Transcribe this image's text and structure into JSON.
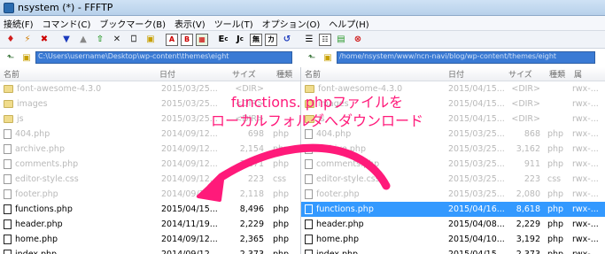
{
  "window": {
    "title": "nsystem (*) - FFFTP"
  },
  "menu": [
    "接続(F)",
    "コマンド(C)",
    "ブックマーク(B)",
    "表示(V)",
    "ツール(T)",
    "オプション(O)",
    "ヘルプ(H)"
  ],
  "toolbar": {
    "icons": [
      "connect-icon",
      "quick-connect-icon",
      "disconnect-icon",
      "download-icon",
      "upload-icon",
      "mirror-upload-icon",
      "delete-icon",
      "rename-icon",
      "mkdir-icon",
      "ascii-mode-icon",
      "binary-mode-icon",
      "auto-mode-icon",
      "ec-icon",
      "jc-icon",
      "kanji-icon",
      "kana-icon",
      "refresh-icon",
      "list-view-icon",
      "detail-view-icon",
      "sync-icon",
      "stop-icon"
    ],
    "labels": {
      "ascii": "A",
      "binary": "B",
      "ec": "E",
      "ec_sub": "c",
      "jc": "J",
      "jc_sub": "c",
      "kanji": "無",
      "kana": "カ"
    }
  },
  "local": {
    "path": "C:\\Users\\username\\Desktop\\wp-content\\themes\\eight",
    "columns": {
      "name": "名前",
      "date": "日付",
      "size": "サイズ",
      "kind": "種類"
    },
    "rows": [
      {
        "name": "font-awesome-4.3.0",
        "date": "2015/03/25...",
        "size": "<DIR>",
        "kind": "",
        "type": "folder",
        "state": "dim"
      },
      {
        "name": "images",
        "date": "2015/03/25...",
        "size": "<DIR>",
        "kind": "",
        "type": "folder",
        "state": "dim"
      },
      {
        "name": "js",
        "date": "2015/03/25...",
        "size": "<DIR>",
        "kind": "",
        "type": "folder",
        "state": "dim"
      },
      {
        "name": "404.php",
        "date": "2014/09/12...",
        "size": "698",
        "kind": "php",
        "type": "file",
        "state": "dim"
      },
      {
        "name": "archive.php",
        "date": "2014/09/12...",
        "size": "2,154",
        "kind": "php",
        "type": "file",
        "state": "dim"
      },
      {
        "name": "comments.php",
        "date": "2014/09/12...",
        "size": "2,171",
        "kind": "php",
        "type": "file",
        "state": "dim"
      },
      {
        "name": "editor-style.css",
        "date": "2014/09/12...",
        "size": "223",
        "kind": "css",
        "type": "file",
        "state": "dim"
      },
      {
        "name": "footer.php",
        "date": "2014/09/12...",
        "size": "2,118",
        "kind": "php",
        "type": "file",
        "state": "dim"
      },
      {
        "name": "functions.php",
        "date": "2015/04/15...",
        "size": "8,496",
        "kind": "php",
        "type": "file",
        "state": "active"
      },
      {
        "name": "header.php",
        "date": "2014/11/19...",
        "size": "2,229",
        "kind": "php",
        "type": "file",
        "state": "active"
      },
      {
        "name": "home.php",
        "date": "2014/09/12...",
        "size": "2,365",
        "kind": "php",
        "type": "file",
        "state": "active"
      },
      {
        "name": "index.php",
        "date": "2014/09/12...",
        "size": "2,373",
        "kind": "php",
        "type": "file",
        "state": "active"
      }
    ]
  },
  "remote": {
    "path": "/home/nsystem/www/ncn-navi/blog/wp-content/themes/eight",
    "columns": {
      "name": "名前",
      "date": "日付",
      "size": "サイズ",
      "kind": "種類",
      "attr": "属"
    },
    "rows": [
      {
        "name": "font-awesome-4.3.0",
        "date": "2015/04/15...",
        "size": "<DIR>",
        "kind": "",
        "attr": "rwx-...",
        "type": "folder",
        "state": "dim"
      },
      {
        "name": "images",
        "date": "2015/04/15...",
        "size": "<DIR>",
        "kind": "",
        "attr": "rwx-...",
        "type": "folder",
        "state": "dim"
      },
      {
        "name": "js",
        "date": "2015/04/15...",
        "size": "<DIR>",
        "kind": "",
        "attr": "rwx-...",
        "type": "folder",
        "state": "dim"
      },
      {
        "name": "404.php",
        "date": "2015/03/25...",
        "size": "868",
        "kind": "php",
        "attr": "rwx-...",
        "type": "file",
        "state": "dim"
      },
      {
        "name": "archive.php",
        "date": "2015/03/25...",
        "size": "3,162",
        "kind": "php",
        "attr": "rwx-...",
        "type": "file",
        "state": "dim"
      },
      {
        "name": "comments.php",
        "date": "2015/03/25...",
        "size": "911",
        "kind": "php",
        "attr": "rwx-...",
        "type": "file",
        "state": "dim"
      },
      {
        "name": "editor-style.css",
        "date": "2015/03/25...",
        "size": "223",
        "kind": "css",
        "attr": "rwx-...",
        "type": "file",
        "state": "dim"
      },
      {
        "name": "footer.php",
        "date": "2015/03/25...",
        "size": "2,080",
        "kind": "php",
        "attr": "rwx-...",
        "type": "file",
        "state": "dim"
      },
      {
        "name": "functions.php",
        "date": "2015/04/16...",
        "size": "8,618",
        "kind": "php",
        "attr": "rwx-...",
        "type": "file",
        "state": "selected"
      },
      {
        "name": "header.php",
        "date": "2015/04/08...",
        "size": "2,229",
        "kind": "php",
        "attr": "rwx-...",
        "type": "file",
        "state": "active"
      },
      {
        "name": "home.php",
        "date": "2015/04/10...",
        "size": "3,192",
        "kind": "php",
        "attr": "rwx-...",
        "type": "file",
        "state": "active"
      },
      {
        "name": "index.php",
        "date": "2015/04/15...",
        "size": "2,373",
        "kind": "php",
        "attr": "rwx-...",
        "type": "file",
        "state": "active"
      }
    ]
  },
  "annotation": {
    "line1": "functions. phpファイルを",
    "line2": "ローカルフォルダへダウンロード",
    "color": "#ff1a7a"
  },
  "colors": {
    "selection": "#3399ff",
    "path_bg": "#3a7ad4"
  }
}
